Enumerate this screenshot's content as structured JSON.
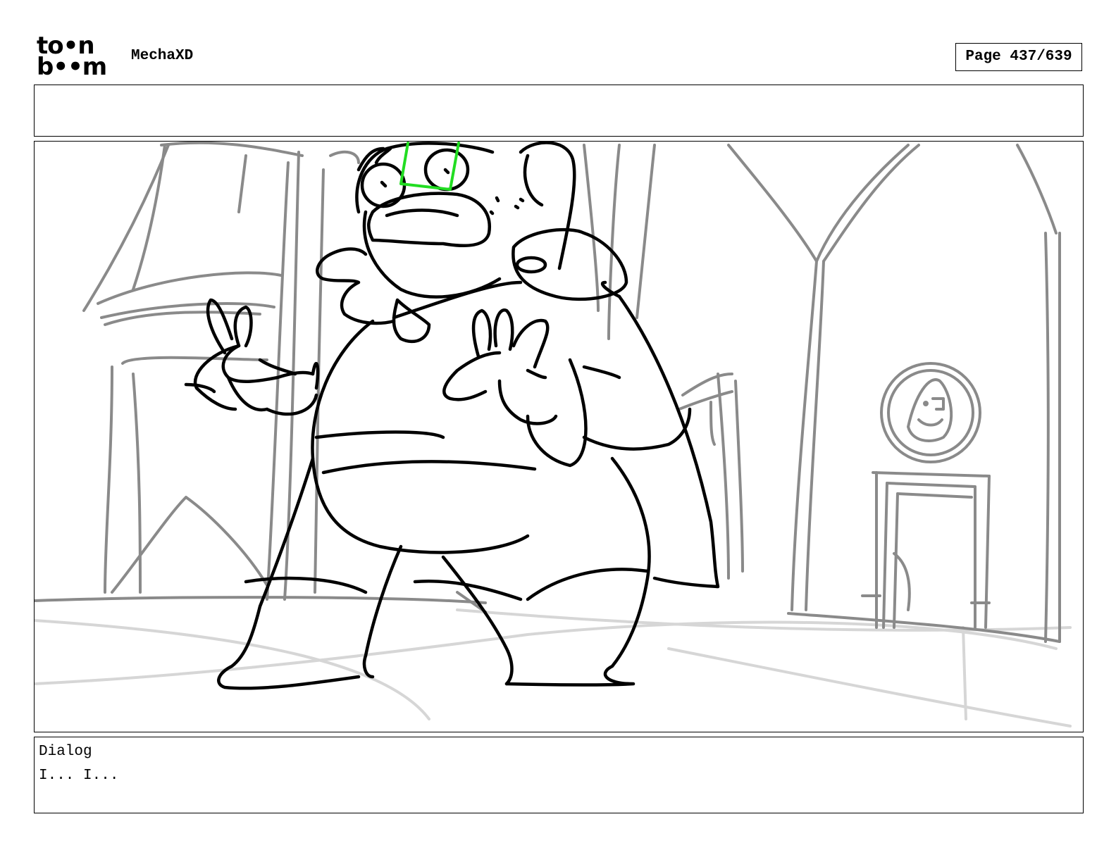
{
  "header": {
    "logo_line1": "to•n",
    "logo_line2": "b••m",
    "logo_icon": "toonboom-logo",
    "project_title": "MechaXD",
    "page_label": "Page 437/639"
  },
  "notes": {
    "text": ""
  },
  "panel": {
    "content": "storyboard-sketch"
  },
  "dialog": {
    "label": "Dialog",
    "text": "I... I..."
  },
  "colors": {
    "ink": "#000000",
    "background_lines": "#808080",
    "floor_lines": "#d0d0d0",
    "highlight": "#22dd22"
  }
}
